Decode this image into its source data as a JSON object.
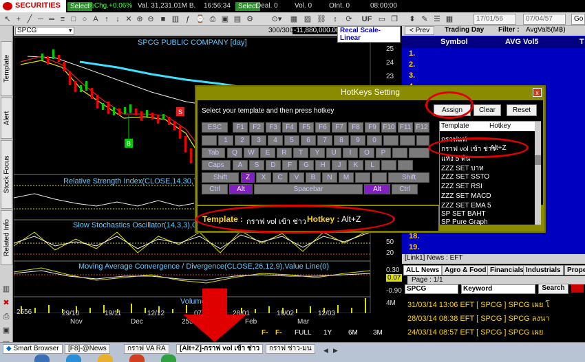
{
  "topbar": {
    "logo": "SECURITIES",
    "select1": "Select",
    "pct_change": "%Chg.+0.06%",
    "value": "Val. 31,231.01M B.",
    "time": "16:56:34",
    "select2": "Select",
    "deal": "Deal. 0",
    "vol": "Vol. 0",
    "oint": "OInt. 0",
    "time2": "08:00:00"
  },
  "toolbar": {
    "symbol": "SPCG",
    "uf": "UF",
    "date_from": "17/01/56",
    "date_to": "07/04/57",
    "go": "Go"
  },
  "left_tabs": [
    "Template",
    "Alert",
    "Stock Focus",
    "Related Info"
  ],
  "chart": {
    "title": "SPCG PUBLIC COMPANY [day]",
    "scale_info": "300/300",
    "neg_value": "-11,880,000.00",
    "scale_button": "Recal Scale-Linear",
    "price_labels": [
      "25",
      "24",
      "23",
      "22",
      "21",
      "20"
    ],
    "rsi_label": "Relative Strength Index(CLOSE,14,30,70)",
    "stoch_label": "Slow Stochastics Oscillator(14,3,3),Ov",
    "stoch_ticks": [
      "50",
      "20"
    ],
    "macd_label": "Moving Average Convergence / Divergence(CLOSE,26,12,9),Value Line(0)",
    "macd_ticks": [
      "0.30",
      "0.07",
      "-0.90"
    ],
    "volume_label": "Volume",
    "volume_tick": "4M",
    "signal_s": "S",
    "signal_b": "B",
    "x_labels": [
      "2556",
      "29/10",
      "Nov",
      "19/11",
      "Dec",
      "12/12",
      "2557",
      "07/01",
      "28/01",
      "Feb",
      "19/02",
      "Mar",
      "12/03"
    ]
  },
  "period_bar": [
    "F-",
    "F-",
    "FULL",
    "1Y",
    "6M",
    "3M"
  ],
  "right_panel": {
    "prev": "< Prev",
    "trading_day": "Trading Day",
    "filter": "Filter :",
    "filter_value": "AvgVal5(M฿)",
    "col_symbol": "Symbol",
    "col_avg": "AVG Vol5",
    "col_t": "T",
    "rows": [
      "1.",
      "2.",
      "3.",
      "4.",
      "18.",
      "19."
    ]
  },
  "news": {
    "header": "[Link1] News : EFT",
    "tabs": [
      "ALL News",
      "Agro & Food",
      "Financials",
      "Industrials",
      "Prope"
    ],
    "page": "Page : 1/1",
    "symbol": "SPCG",
    "keyword_label": "Keyword",
    "search": "Search",
    "lines": [
      "31/03/14 13:06  EFT  [ SPCG ]  SPCG เผย โ",
      "28/03/14 08:38  EFT  [ SPCG ]  SPCG ลงนา",
      "24/03/14 08:57  EFT  [ SPCG ]  SPCG เผย"
    ]
  },
  "dialog": {
    "title": "HotKeys Setting",
    "instruction": "Select your template and then press hotkey",
    "assign": "Assign",
    "clear": "Clear",
    "reset": "Reset",
    "close": "x",
    "keys": {
      "row0": [
        "ESC",
        "F1",
        "F2",
        "F3",
        "F4",
        "F5",
        "F6",
        "F7",
        "F8",
        "F9",
        "F10",
        "F11",
        "F12"
      ],
      "row1": [
        "1",
        "2",
        "3",
        "4",
        "5",
        "6",
        "7",
        "8",
        "9",
        "0"
      ],
      "row2": [
        "Tab",
        "Q",
        "W",
        "E",
        "R",
        "T",
        "Y",
        "U",
        "I",
        "O",
        "P"
      ],
      "row3": [
        "Caps",
        "A",
        "S",
        "D",
        "F",
        "G",
        "H",
        "J",
        "K",
        "L"
      ],
      "row4": [
        "Shift",
        "Z",
        "X",
        "C",
        "V",
        "B",
        "N",
        "M",
        "Shift"
      ],
      "row5": [
        "Ctrl",
        "Alt",
        "Spacebar",
        "Alt",
        "Ctrl"
      ]
    },
    "list_header_template": "Template",
    "list_header_hotkey": "Hotkey",
    "templates": [
      {
        "name": "กราฟแท่",
        "hotkey": ""
      },
      {
        "name": "กราฟ vol เข้า ช่าว",
        "hotkey": "Alt+Z"
      },
      {
        "name": "แท้ง 5 ต้น",
        "hotkey": ""
      },
      {
        "name": "ZZZ SET บาท",
        "hotkey": ""
      },
      {
        "name": "ZZZ SET SSTO",
        "hotkey": ""
      },
      {
        "name": "ZZZ SET RSI",
        "hotkey": ""
      },
      {
        "name": "ZZZ SET MACD",
        "hotkey": ""
      },
      {
        "name": "ZZZ SET EMA 5",
        "hotkey": ""
      },
      {
        "name": "SP SET BAHT",
        "hotkey": ""
      },
      {
        "name": "SP Pure Graph",
        "hotkey": ""
      }
    ],
    "footer_template_label": "Template :",
    "footer_template_value": "กราฟ vol เข้า ช่าว",
    "footer_hotkey_label": "Hotkey :",
    "footer_hotkey_value": "Alt+Z"
  },
  "taskbar": {
    "smart_browser": "Smart Browser",
    "tasks": [
      "[F8]-@News",
      "กราฟ VA RA",
      "[Alt+Z]-กราฟ vol เข้า ช่าว",
      "กราฟ ช่าว-มน"
    ]
  },
  "colors": {
    "annotation": "#e00000",
    "highlight_key": "#8020c0",
    "dialog_frame": "#8b8b00",
    "panel_blue": "#0000c0",
    "news_yellow": "#ffd700"
  }
}
